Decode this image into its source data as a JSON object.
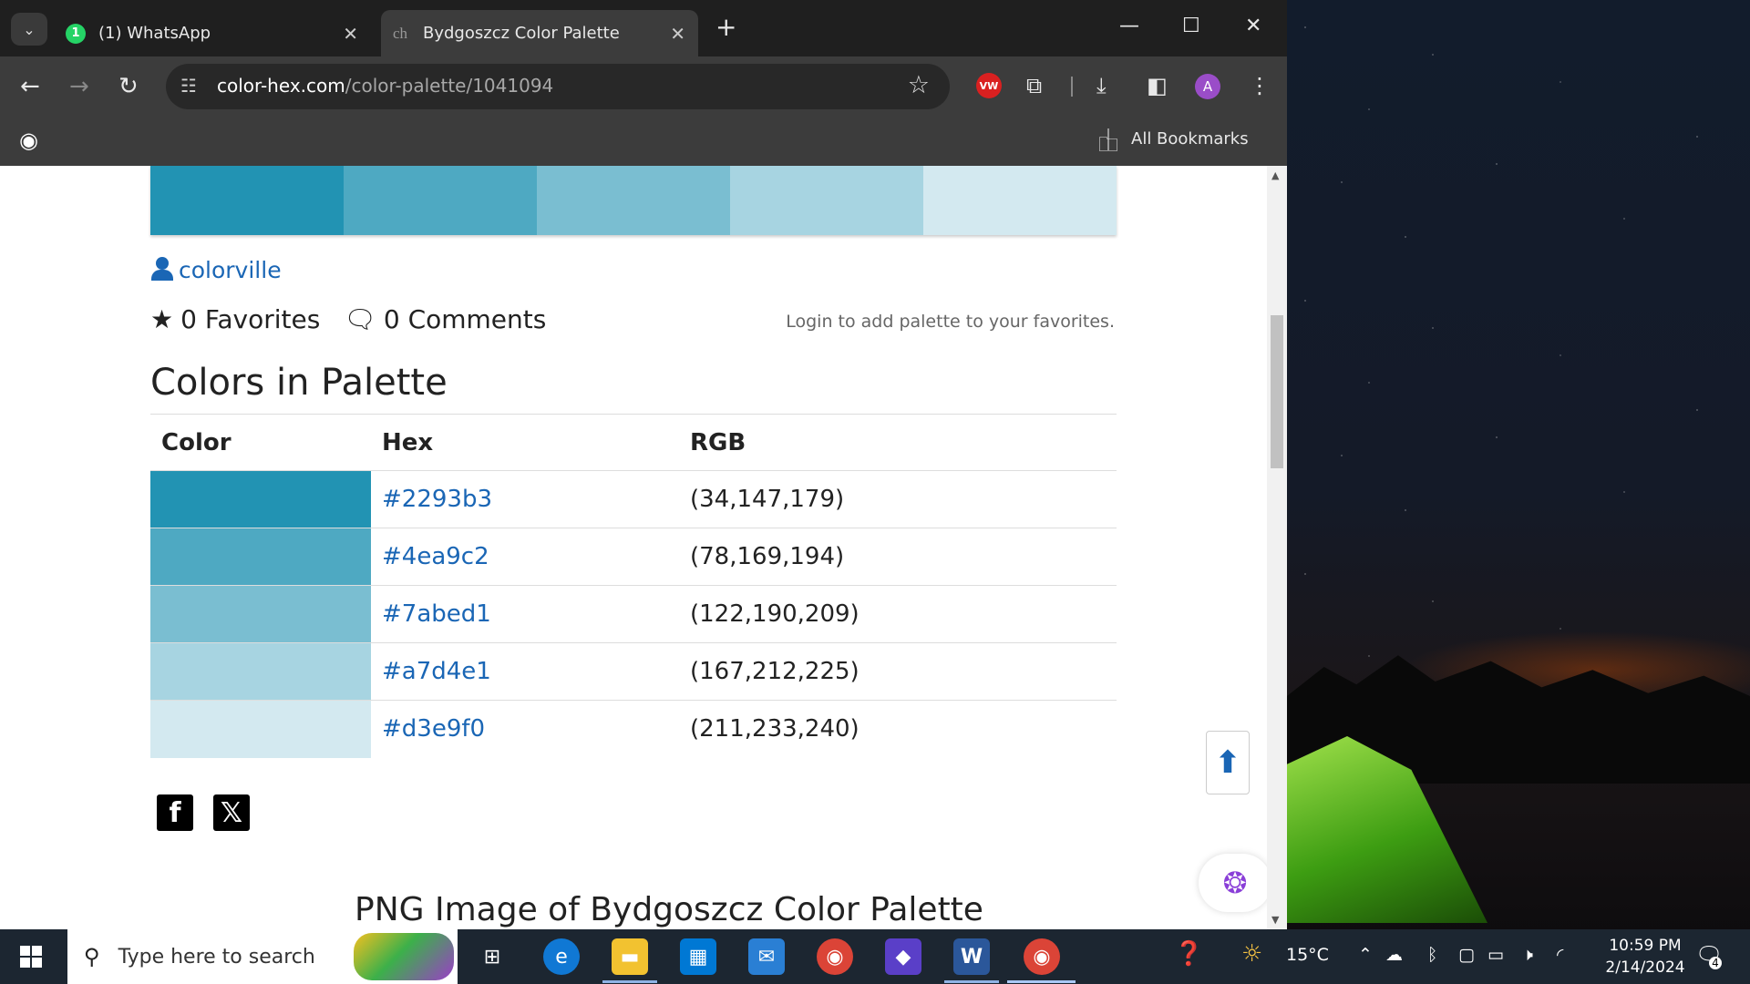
{
  "tabs": [
    {
      "title": "(1) WhatsApp",
      "badge": "1"
    },
    {
      "title": "Bydgoszcz Color Palette",
      "favicon_text": "ch"
    }
  ],
  "address_bar": {
    "domain": "color-hex.com",
    "path": "/color-palette/1041094"
  },
  "toolbar": {
    "ext_label": "VW",
    "avatar_letter": "A"
  },
  "bookmarks": {
    "all_label": "All Bookmarks"
  },
  "page": {
    "author": "colorville",
    "favorites": "0 Favorites",
    "comments": "0 Comments",
    "login_message": "Login to add palette to your favorites.",
    "colors_title": "Colors in Palette",
    "table_headers": {
      "color": "Color",
      "hex": "Hex",
      "rgb": "RGB"
    },
    "colors": [
      {
        "hex": "#2293b3",
        "rgb": "(34,147,179)"
      },
      {
        "hex": "#4ea9c2",
        "rgb": "(78,169,194)"
      },
      {
        "hex": "#7abed1",
        "rgb": "(122,190,209)"
      },
      {
        "hex": "#a7d4e1",
        "rgb": "(167,212,225)"
      },
      {
        "hex": "#d3e9f0",
        "rgb": "(211,233,240)"
      }
    ],
    "share_icons": [
      "facebook-icon",
      "x-icon"
    ],
    "png_title": "PNG Image of Bydgoszcz Color Palette"
  },
  "taskbar": {
    "search_placeholder": "Type here to search",
    "temperature": "15°C",
    "time": "10:59 PM",
    "date": "2/14/2024",
    "notification_count": "4"
  },
  "colors": {
    "link": "#1a66b5",
    "tab_bar": "#1f1f1f",
    "toolbar": "#3c3c3c",
    "taskbar": "#1c2631"
  }
}
